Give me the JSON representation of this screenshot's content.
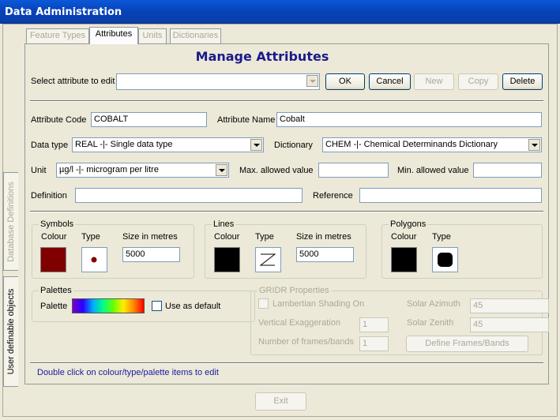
{
  "window": {
    "title": "Data Administration"
  },
  "side_tabs": [
    {
      "label": "User definable objects"
    },
    {
      "label": "Database Definitions"
    }
  ],
  "tabs": [
    {
      "label": "Feature Types"
    },
    {
      "label": "Attributes"
    },
    {
      "label": "Units"
    },
    {
      "label": "Dictionaries"
    }
  ],
  "page_title": "Manage Attributes",
  "select_attribute": {
    "label": "Select attribute to edit",
    "value": ""
  },
  "buttons": {
    "ok": "OK",
    "cancel": "Cancel",
    "new": "New",
    "copy": "Copy",
    "delete": "Delete",
    "exit": "Exit"
  },
  "attribute": {
    "code_label": "Attribute Code",
    "code_value": "COBALT",
    "name_label": "Attribute Name",
    "name_value": "Cobalt",
    "datatype_label": "Data type",
    "datatype_value": "REAL -|- Single data type",
    "dictionary_label": "Dictionary",
    "dictionary_value": "CHEM -|- Chemical Determinands Dictionary",
    "unit_label": "Unit",
    "unit_value": "µg/l -|- microgram per litre",
    "max_label": "Max. allowed value",
    "max_value": "",
    "min_label": "Min. allowed value",
    "min_value": "",
    "definition_label": "Definition",
    "definition_value": "",
    "reference_label": "Reference",
    "reference_value": ""
  },
  "symbols": {
    "legend": "Symbols",
    "colour_label": "Colour",
    "type_label": "Type",
    "size_label": "Size in metres",
    "size_value": "5000",
    "colour": "#800000"
  },
  "lines": {
    "legend": "Lines",
    "colour_label": "Colour",
    "type_label": "Type",
    "size_label": "Size in metres",
    "size_value": "5000",
    "colour": "#000000"
  },
  "polygons": {
    "legend": "Polygons",
    "colour_label": "Colour",
    "type_label": "Type",
    "colour": "#000000"
  },
  "palettes": {
    "legend": "Palettes",
    "palette_label": "Palette",
    "default_label": "Use as default"
  },
  "gridr": {
    "legend": "GRIDR Properties",
    "lambertian_label": "Lambertian Shading On",
    "vertical_label": "Vertical Exaggeration",
    "vertical_value": "1",
    "frames_label": "Number of frames/bands",
    "frames_value": "1",
    "azimuth_label": "Solar Azimuth",
    "azimuth_value": "45",
    "zenith_label": "Solar Zenith",
    "zenith_value": "45",
    "define_button": "Define Frames/Bands"
  },
  "hint": "Double click on colour/type/palette items to edit"
}
